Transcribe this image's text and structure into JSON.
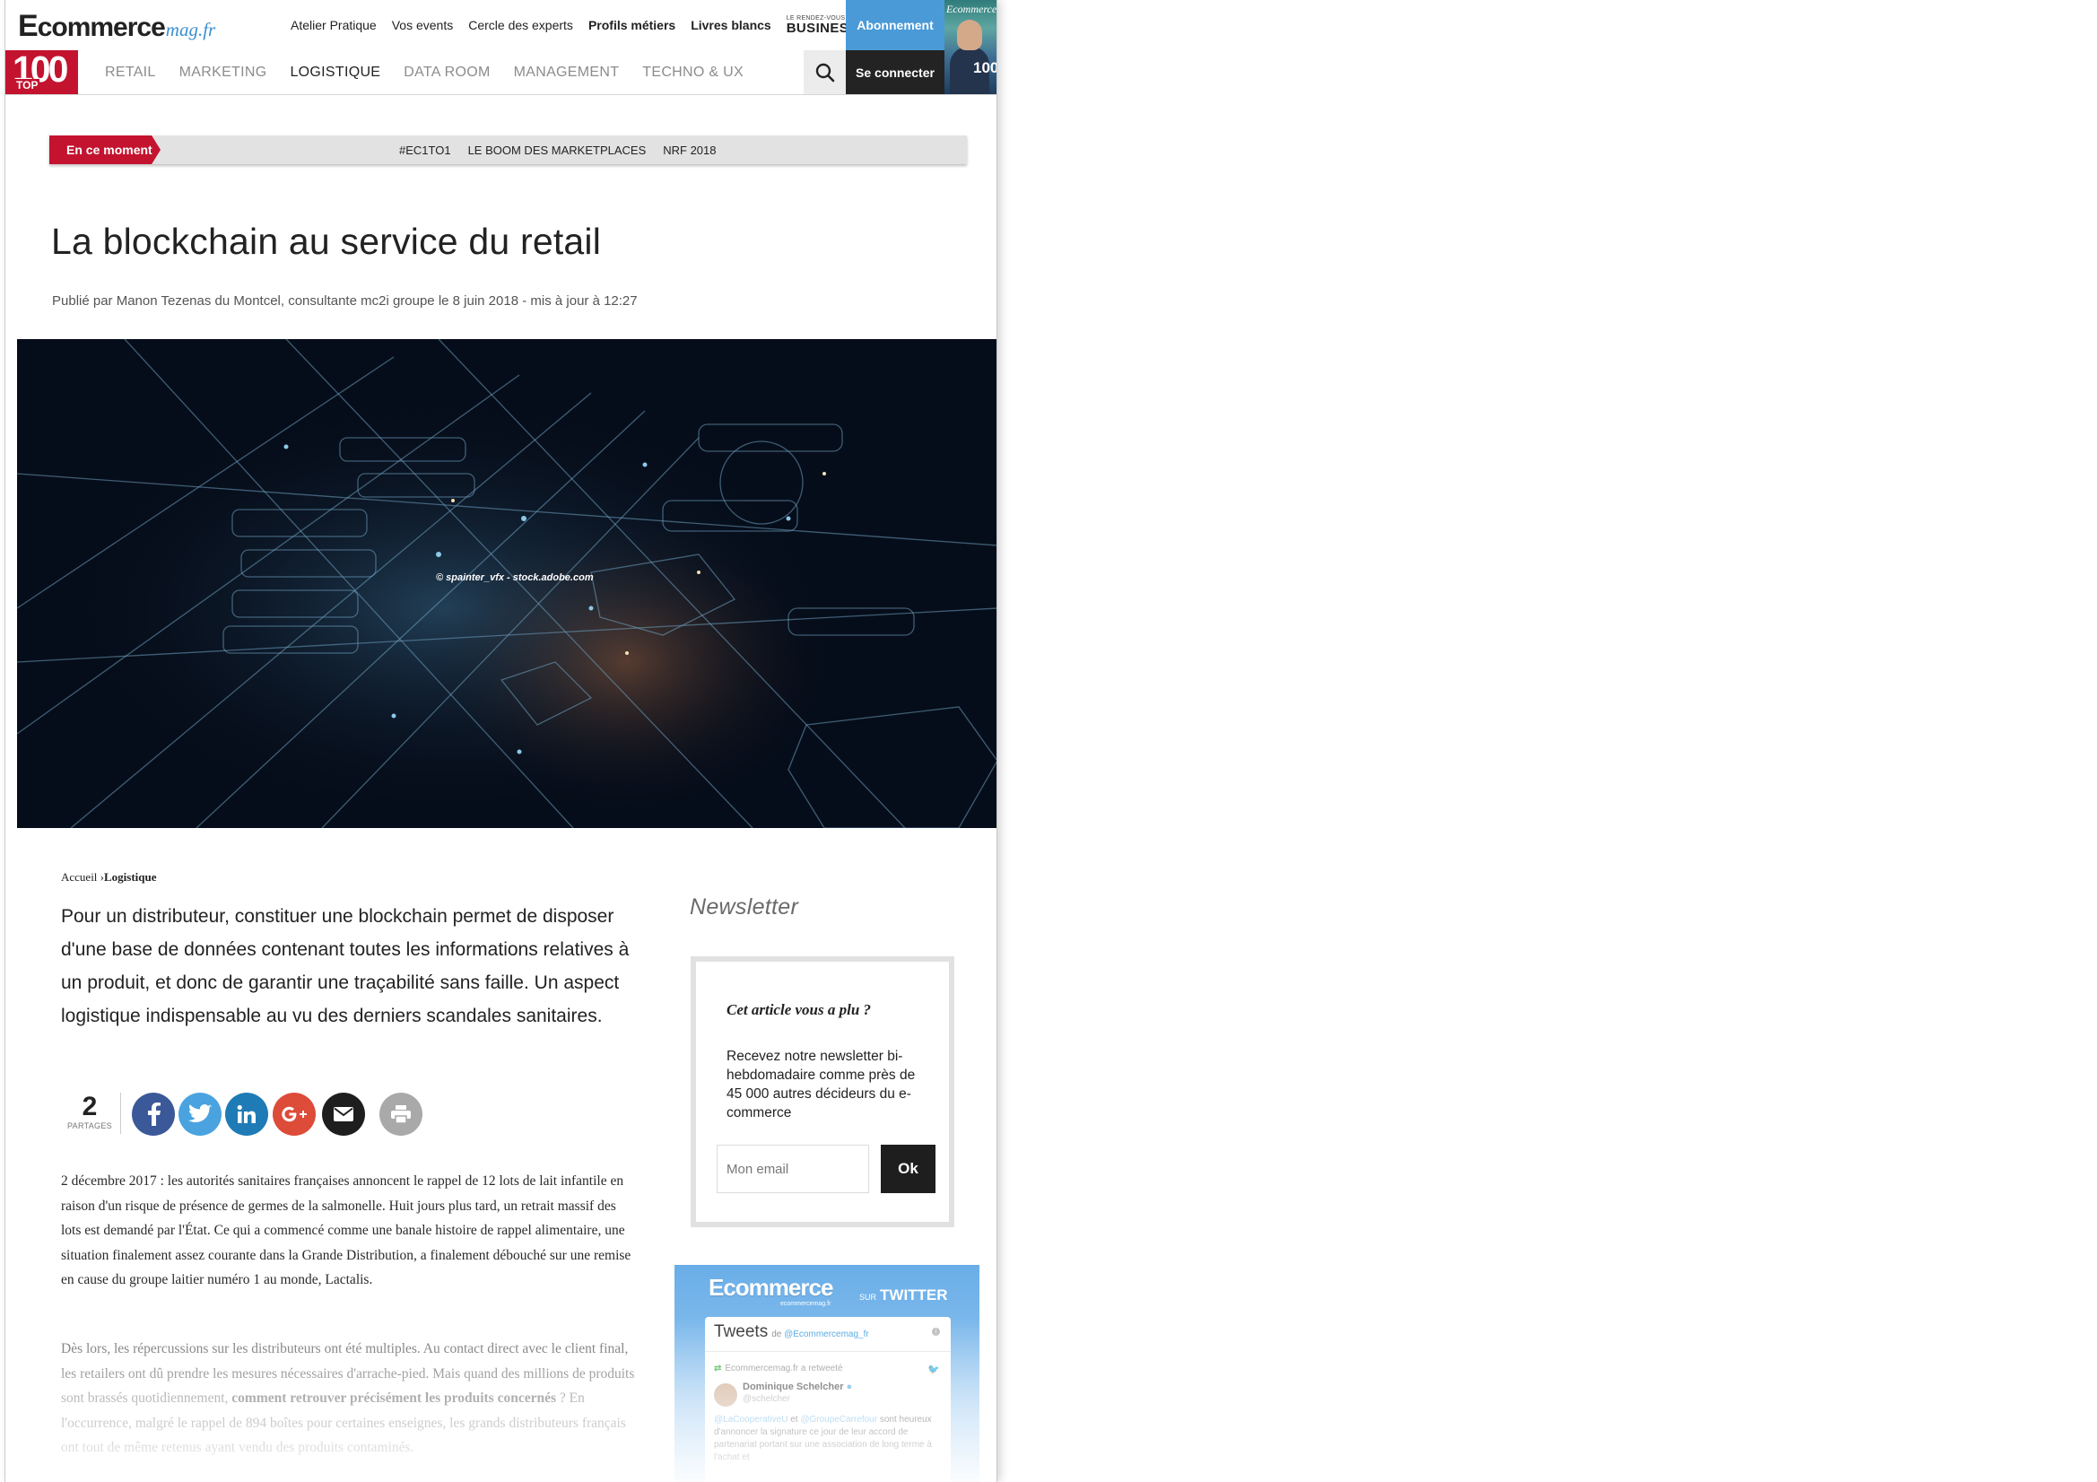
{
  "header": {
    "logo_main_e": "E",
    "logo_main_rest": "commerce",
    "logo_sub": "mag.fr",
    "top_links": [
      "Atelier Pratique",
      "Vos events",
      "Cercle des experts",
      "Profils métiers",
      "Livres blancs"
    ],
    "rdv_small": "LE RENDEZ-VOUS",
    "rdv_big": "BUSINESS",
    "abonnement": "Abonnement",
    "top100_num": "100",
    "top100_label": "TOP",
    "nav": [
      "RETAIL",
      "MARKETING",
      "LOGISTIQUE",
      "DATA ROOM",
      "MANAGEMENT",
      "TECHNO & UX"
    ],
    "nav_active": "LOGISTIQUE",
    "connect": "Se connecter",
    "mag_title": "Ecommerce",
    "mag_num": "100"
  },
  "moment": {
    "label": "En ce moment",
    "tags": [
      "#EC1TO1",
      "LE BOOM DES MARKETPLACES",
      "NRF 2018"
    ]
  },
  "article": {
    "title": "La blockchain au service du retail",
    "byline": "Publié par Manon Tezenas du Montcel, consultante mc2i groupe le 8 juin 2018 - mis à jour à 12:27",
    "image_credit": "© spainter_vfx - stock.adobe.com",
    "breadcrumb_home": "Accueil",
    "breadcrumb_sep": "›",
    "breadcrumb_current": "Logistique",
    "lead": "Pour un distributeur, constituer une blockchain permet de disposer d'une base de données contenant toutes les informations relatives à un produit, et donc de garantir une traçabilité sans faille. Un aspect logistique indispensable au vu des derniers scandales sanitaires.",
    "share_count": "2",
    "share_label": "PARTAGES",
    "p1": "2 décembre 2017 : les autorités sanitaires françaises annoncent le rappel de 12 lots de lait infantile en raison d'un risque de présence de germes de la salmonelle. Huit jours plus tard, un retrait massif des lots est demandé par l'État. Ce qui a commencé comme une banale histoire de rappel alimentaire, une situation finalement assez courante dans la Grande Distribution, a finalement débouché sur une remise en cause du groupe laitier numéro 1 au monde, Lactalis.",
    "p2_a": "Dès lors, les répercussions sur les distributeurs ont été multiples. Au contact direct avec le client final, les retailers ont dû prendre les mesures nécessaires d'arrache-pied. Mais quand des millions de produits sont brassés quotidiennement, ",
    "p2_bold": "comment retrouver précisément les produits concernés",
    "p2_b": " ? En l'occurrence, malgré le rappel de 894 boîtes pour certaines enseignes, les grands distributeurs français ont tout de même retenus ayant vendu des produits contaminés."
  },
  "newsletter": {
    "heading": "Newsletter",
    "question": "Cet article vous a plu ?",
    "text": "Recevez notre newsletter bi-hebdomadaire comme près de 45 000 autres décideurs du e-commerce",
    "placeholder": "Mon email",
    "ok": "Ok"
  },
  "twitter": {
    "logo_e": "E",
    "logo_rest": "commerce",
    "logo_sub": "ecommercemag.fr",
    "sur": "SUR",
    "twitter": "TWITTER",
    "tweets": "Tweets",
    "de": "de",
    "handle": "@Ecommercemag_fr",
    "retweet": "Ecommercemag.fr a retweeté",
    "author": "Dominique Schelcher",
    "author_handle": "@schelcher",
    "text_mention1": "@LaCooperativeU",
    "text_et": " et ",
    "text_mention2": "@GroupeCarrefour",
    "text_rest": " sont heureux d'annoncer la signature ce jour de leur accord de partenariat portant sur une association de long terme à l'achat et"
  },
  "colors": {
    "brand_red": "#c3132f",
    "brand_blue": "#4a9ad8",
    "dark": "#1e1e1e"
  }
}
